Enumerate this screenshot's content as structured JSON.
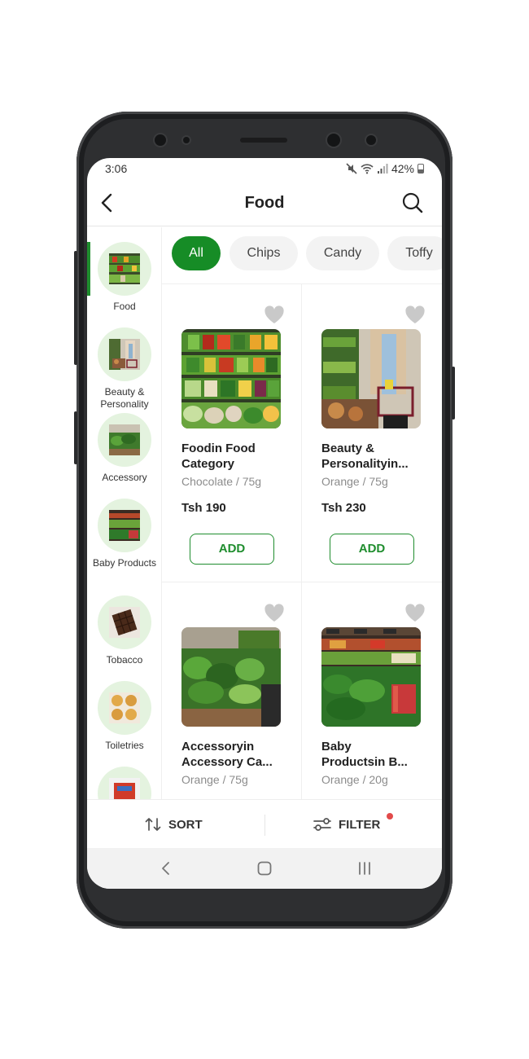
{
  "status_bar": {
    "time": "3:06",
    "battery": "42%"
  },
  "header": {
    "title": "Food"
  },
  "chips": [
    {
      "label": "All",
      "active": true
    },
    {
      "label": "Chips",
      "active": false
    },
    {
      "label": "Candy",
      "active": false
    },
    {
      "label": "Toffy",
      "active": false
    }
  ],
  "sidebar": {
    "items": [
      {
        "label": "Food",
        "active": true,
        "image": "produce-shelf"
      },
      {
        "label": "Beauty & Personality",
        "active": false,
        "image": "shopper-with-cart"
      },
      {
        "label": "Accessory",
        "active": false,
        "image": "greens-aisle"
      },
      {
        "label": "Baby Products",
        "active": false,
        "image": "market-stall"
      },
      {
        "label": "Tobacco",
        "active": false,
        "image": "chocolate-bar"
      },
      {
        "label": "Toiletries",
        "active": false,
        "image": "biscuits"
      },
      {
        "label": "",
        "active": false,
        "image": "red-pack"
      }
    ]
  },
  "products": [
    {
      "name_line1": "Foodin Food",
      "name_line2": "Category",
      "variant": "Chocolate / 75g",
      "price": "Tsh 190",
      "add_label": "ADD",
      "image": "produce-shelf"
    },
    {
      "name_line1": "Beauty &",
      "name_line2": "Personalityin...",
      "variant": "Orange / 75g",
      "price": "Tsh 230",
      "add_label": "ADD",
      "image": "shopper-with-cart"
    },
    {
      "name_line1": "Accessoryin",
      "name_line2": "Accessory Ca...",
      "variant": "Orange / 75g",
      "price": "",
      "add_label": "",
      "image": "greens-aisle"
    },
    {
      "name_line1": "Baby",
      "name_line2": "Productsin B...",
      "variant": "Orange / 20g",
      "price": "",
      "add_label": "",
      "image": "market-stall"
    }
  ],
  "bottom_bar": {
    "sort_label": "SORT",
    "filter_label": "FILTER",
    "filter_active": true
  },
  "colors": {
    "accent": "#168c26",
    "chip_bg": "#f3f3f3",
    "circle_bg": "#e4f3df",
    "badge": "#e24a4a"
  }
}
